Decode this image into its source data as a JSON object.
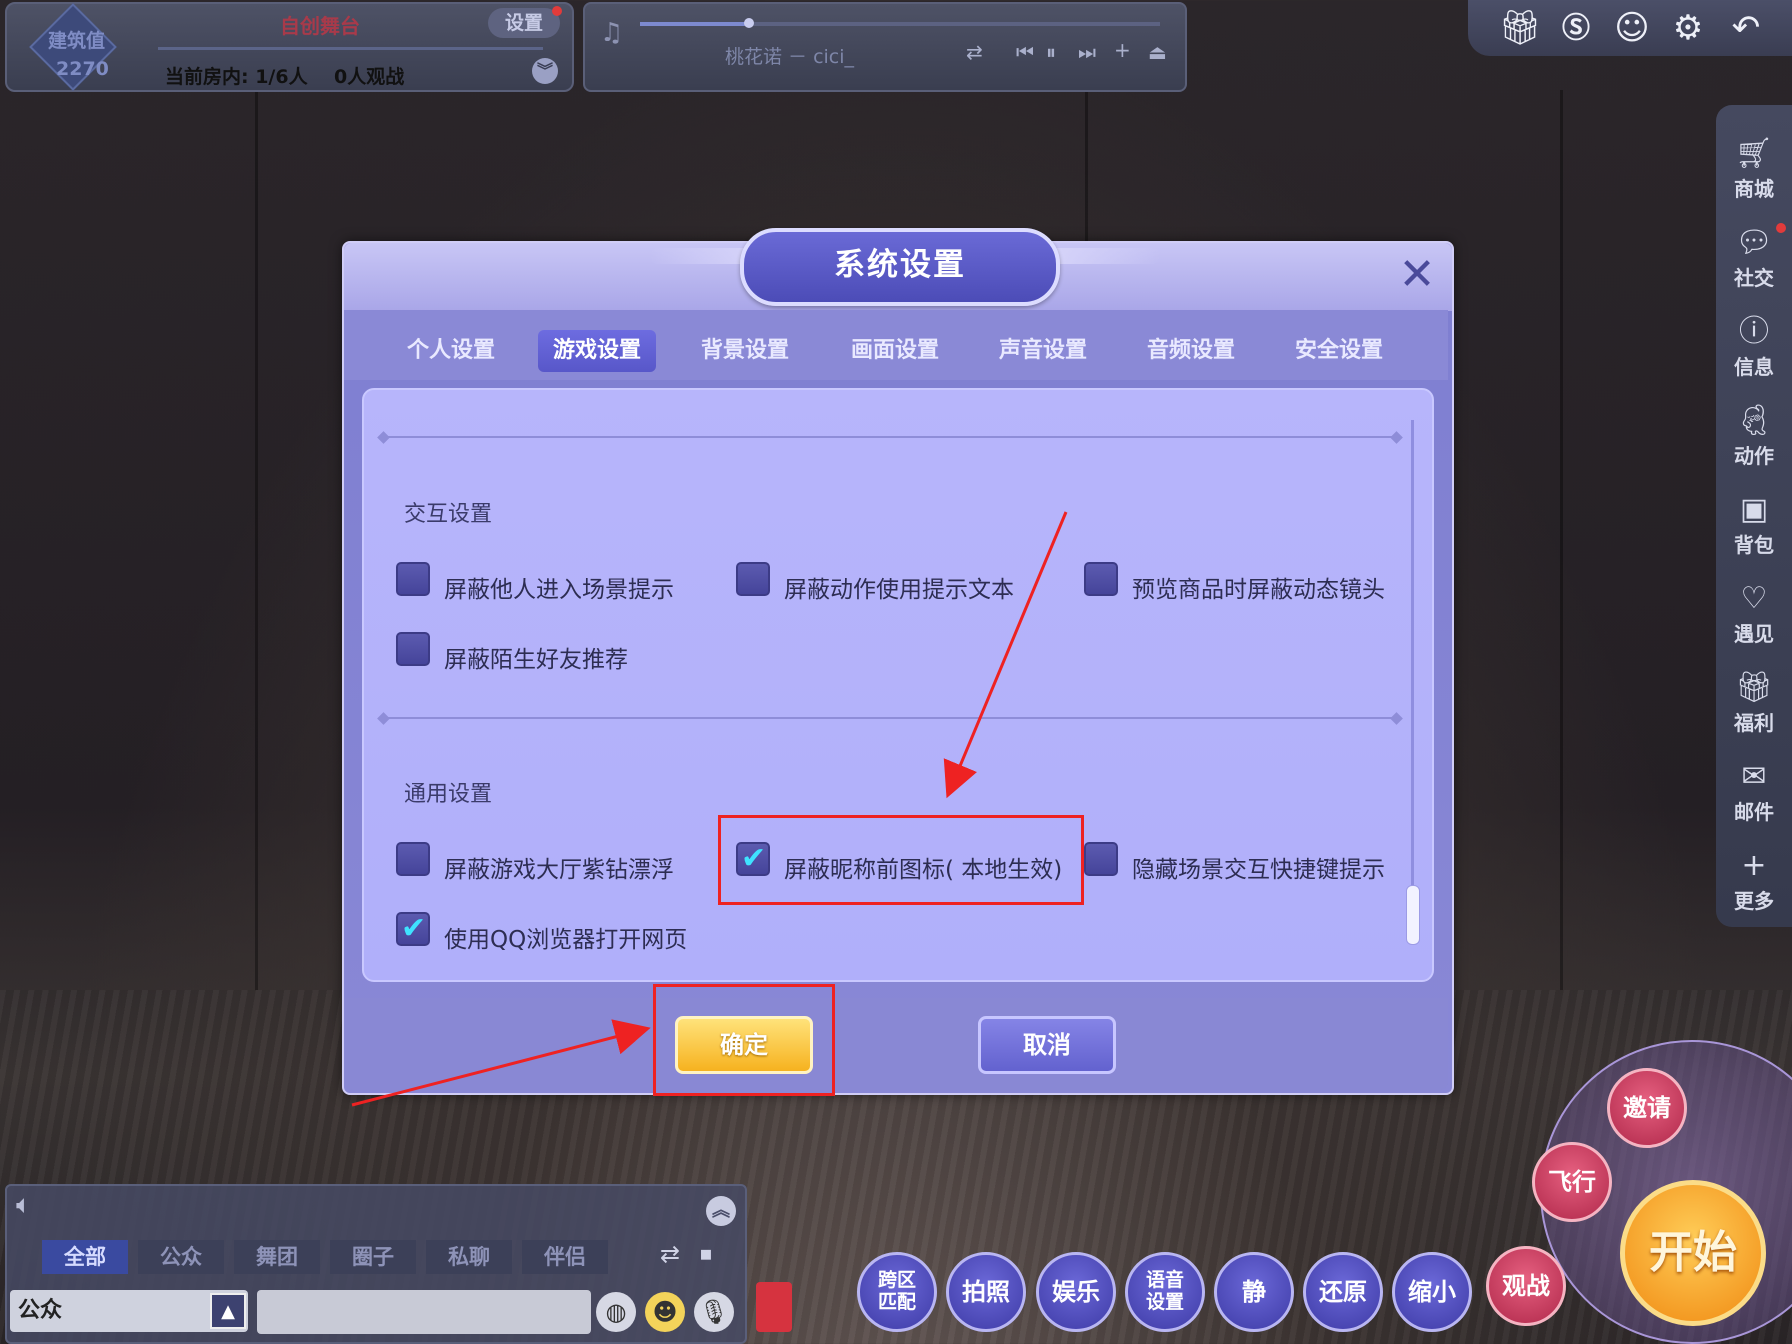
{
  "top_info": {
    "diamond_title": "建筑值",
    "diamond_value": "2270",
    "room_title": "自创舞台",
    "settings_label": "设置",
    "room_status": "当前房内: 1/6人    0人观战"
  },
  "music": {
    "song": "桃花诺 － cici_",
    "progress_fraction": 0.21
  },
  "top_icons": [
    "gift-icon",
    "dollar-icon",
    "face-icon",
    "gear-icon",
    "back-arrow-icon"
  ],
  "side_menu": [
    {
      "label": "商城",
      "icon": "cart-icon"
    },
    {
      "label": "社交",
      "icon": "chat-bubble-icon"
    },
    {
      "label": "信息",
      "icon": "info-icon"
    },
    {
      "label": "动作",
      "icon": "dance-icon"
    },
    {
      "label": "背包",
      "icon": "bag-icon"
    },
    {
      "label": "遇见",
      "icon": "heart-icon"
    },
    {
      "label": "福利",
      "icon": "gift-icon"
    },
    {
      "label": "邮件",
      "icon": "mail-icon"
    },
    {
      "label": "更多",
      "icon": "plus-icon"
    }
  ],
  "dialog": {
    "title": "系统设置",
    "tabs": [
      "个人设置",
      "游戏设置",
      "背景设置",
      "画面设置",
      "声音设置",
      "音频设置",
      "安全设置"
    ],
    "active_tab": "游戏设置",
    "sections": [
      {
        "title": "交互设置",
        "options": [
          {
            "label": "屏蔽他人进入场景提示",
            "checked": false
          },
          {
            "label": "屏蔽动作使用提示文本",
            "checked": false
          },
          {
            "label": "预览商品时屏蔽动态镜头",
            "checked": false
          },
          {
            "label": "屏蔽陌生好友推荐",
            "checked": false
          }
        ]
      },
      {
        "title": "通用设置",
        "options": [
          {
            "label": "屏蔽游戏大厅紫钻漂浮",
            "checked": false
          },
          {
            "label": "屏蔽昵称前图标( 本地生效)",
            "checked": true
          },
          {
            "label": "隐藏场景交互快捷键提示",
            "checked": false
          },
          {
            "label": "使用QQ浏览器打开网页",
            "checked": true
          }
        ]
      }
    ],
    "confirm_label": "确定",
    "cancel_label": "取消"
  },
  "chat": {
    "tabs": [
      "全部",
      "公众",
      "舞团",
      "圈子",
      "私聊",
      "伴侣"
    ],
    "active_tab": "全部",
    "channel": "公众",
    "input_value": ""
  },
  "actions": {
    "cross_match": "跨区\n匹配",
    "photo": "拍照",
    "fun": "娱乐",
    "voice": "语音\n设置",
    "mute": "静",
    "restore": "还原",
    "shrink": "缩小",
    "spectate": "观战",
    "fly": "飞行",
    "invite": "邀请",
    "start": "开始"
  },
  "colors": {
    "dialog_bg": "#8988d6",
    "content_bg": "#b5b3fa",
    "checkbox_fill": "#4f4ea4",
    "check_mark": "#3fe3ff",
    "confirm_btn": "#f6b21f",
    "cancel_btn": "#6f6edb",
    "annotation_red": "#ee2222"
  }
}
